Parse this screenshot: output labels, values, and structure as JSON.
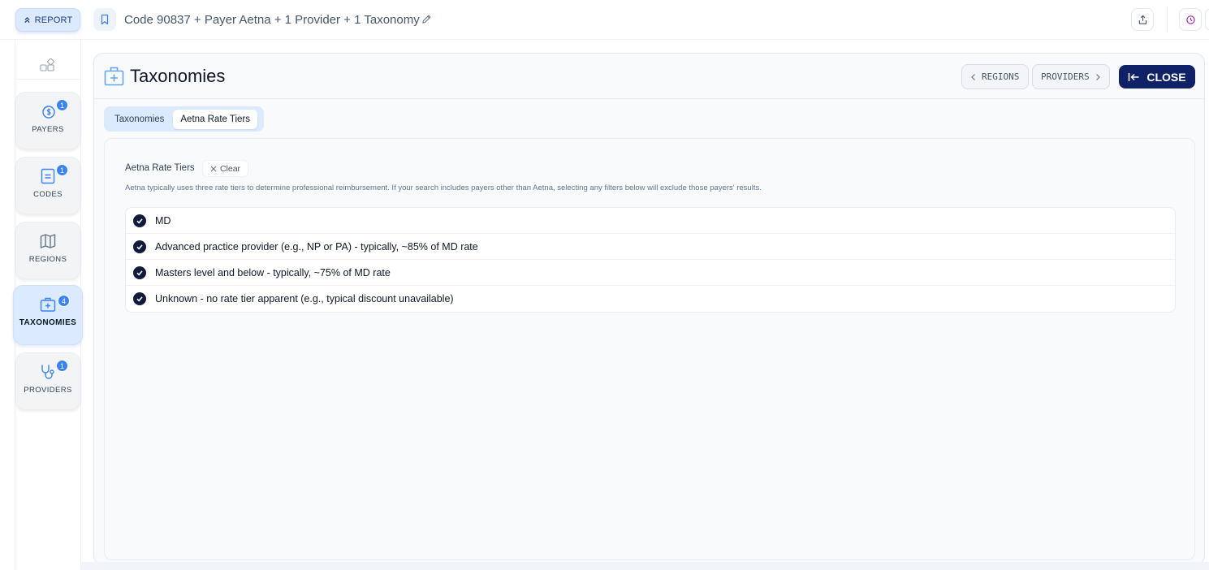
{
  "topbar": {
    "report_label": "REPORT",
    "report_title": "Code 90837 + Payer Aetna + 1 Provider + 1 Taxonomy"
  },
  "sidebar": {
    "items": [
      {
        "label": "PAYERS",
        "badge": "1",
        "icon": "dollar-coins-icon"
      },
      {
        "label": "CODES",
        "badge": "1",
        "icon": "document-list-icon"
      },
      {
        "label": "REGIONS",
        "badge": "",
        "icon": "map-icon"
      },
      {
        "label": "TAXONOMIES",
        "badge": "4",
        "icon": "medical-kit-icon",
        "active": true
      },
      {
        "label": "PROVIDERS",
        "badge": "1",
        "icon": "stethoscope-icon"
      }
    ]
  },
  "panel": {
    "title": "Taxonomies",
    "prev_label": "REGIONS",
    "next_label": "PROVIDERS",
    "close_label": "CLOSE",
    "tabs": [
      {
        "label": "Taxonomies",
        "selected": false
      },
      {
        "label": "Aetna Rate Tiers",
        "selected": true
      }
    ],
    "filter": {
      "label": "Aetna Rate Tiers",
      "clear_label": "Clear",
      "description": "Aetna typically uses three rate tiers to determine professional reimbursement. If your search includes payers other than Aetna, selecting any filters below will exclude those payers' results.",
      "options": [
        {
          "label": "MD",
          "checked": true
        },
        {
          "label": "Advanced practice provider (e.g., NP or PA) - typically, ~85% of MD rate",
          "checked": true
        },
        {
          "label": "Masters level and below - typically, ~75% of MD rate",
          "checked": true
        },
        {
          "label": "Unknown - no rate tier apparent (e.g., typical discount unavailable)",
          "checked": true
        }
      ]
    }
  },
  "colors": {
    "accent_light": "#dbeafe",
    "accent": "#3b82f6",
    "close_bg": "#0f2268",
    "checkbox": "#0f1a3d"
  }
}
